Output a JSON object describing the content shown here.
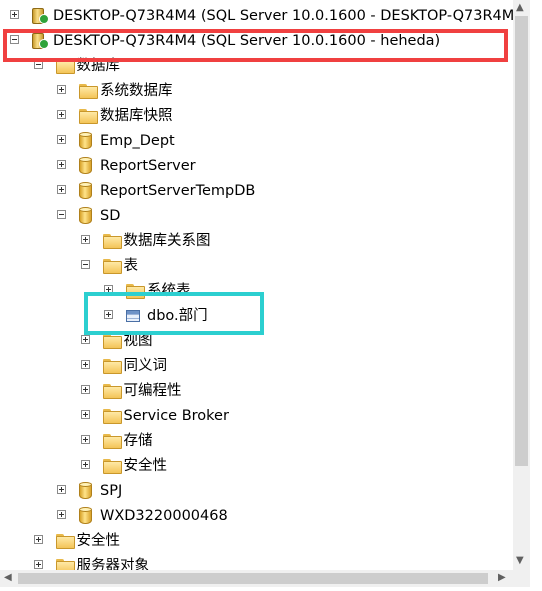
{
  "tree": [
    {
      "name": "server-node-1",
      "icon": "server-icon",
      "expander": "plus",
      "level": 0,
      "label": "DESKTOP-Q73R4M4 (SQL Server 10.0.1600 - DESKTOP-Q73R4M"
    },
    {
      "name": "server-node-2",
      "icon": "server-icon",
      "expander": "minus",
      "level": 0,
      "label": "DESKTOP-Q73R4M4 (SQL Server 10.0.1600 - heheda)"
    },
    {
      "name": "databases-folder",
      "icon": "folder-icon",
      "expander": "minus",
      "level": 1,
      "label": "数据库"
    },
    {
      "name": "system-databases-folder",
      "icon": "folder-icon",
      "expander": "plus",
      "level": 2,
      "label": "系统数据库"
    },
    {
      "name": "database-snapshots-folder",
      "icon": "folder-icon",
      "expander": "plus",
      "level": 2,
      "label": "数据库快照"
    },
    {
      "name": "db-emp-dept",
      "icon": "database-icon",
      "expander": "plus",
      "level": 2,
      "label": "Emp_Dept"
    },
    {
      "name": "db-reportserver",
      "icon": "database-icon",
      "expander": "plus",
      "level": 2,
      "label": "ReportServer"
    },
    {
      "name": "db-reportservertempdb",
      "icon": "database-icon",
      "expander": "plus",
      "level": 2,
      "label": "ReportServerTempDB"
    },
    {
      "name": "db-sd",
      "icon": "database-icon",
      "expander": "minus",
      "level": 2,
      "label": "SD"
    },
    {
      "name": "sd-diagrams-folder",
      "icon": "folder-icon",
      "expander": "plus",
      "level": 3,
      "label": "数据库关系图"
    },
    {
      "name": "sd-tables-folder",
      "icon": "folder-icon",
      "expander": "minus",
      "level": 3,
      "label": "表"
    },
    {
      "name": "sd-system-tables-folder",
      "icon": "folder-icon",
      "expander": "plus",
      "level": 4,
      "label": "系统表"
    },
    {
      "name": "table-dbo-department",
      "icon": "table-icon",
      "expander": "plus",
      "level": 4,
      "label": "dbo.部门"
    },
    {
      "name": "sd-views-folder",
      "icon": "folder-icon",
      "expander": "plus",
      "level": 3,
      "label": "视图"
    },
    {
      "name": "sd-synonyms-folder",
      "icon": "folder-icon",
      "expander": "plus",
      "level": 3,
      "label": "同义词"
    },
    {
      "name": "sd-programmability-folder",
      "icon": "folder-icon",
      "expander": "plus",
      "level": 3,
      "label": "可编程性"
    },
    {
      "name": "sd-service-broker-folder",
      "icon": "folder-icon",
      "expander": "plus",
      "level": 3,
      "label": "Service Broker"
    },
    {
      "name": "sd-storage-folder",
      "icon": "folder-icon",
      "expander": "plus",
      "level": 3,
      "label": "存储"
    },
    {
      "name": "sd-security-folder",
      "icon": "folder-icon",
      "expander": "plus",
      "level": 3,
      "label": "安全性"
    },
    {
      "name": "db-spj",
      "icon": "database-icon",
      "expander": "plus",
      "level": 2,
      "label": "SPJ"
    },
    {
      "name": "db-wxd3220000468",
      "icon": "database-icon",
      "expander": "plus",
      "level": 2,
      "label": "WXD3220000468"
    },
    {
      "name": "security-folder",
      "icon": "folder-icon",
      "expander": "plus",
      "level": 1,
      "label": "安全性"
    },
    {
      "name": "server-objects-folder",
      "icon": "folder-icon",
      "expander": "plus",
      "level": 1,
      "label": "服务器对象"
    }
  ],
  "colors": {
    "highlight_red": "#f04040",
    "highlight_cyan": "#2ccfd0"
  }
}
